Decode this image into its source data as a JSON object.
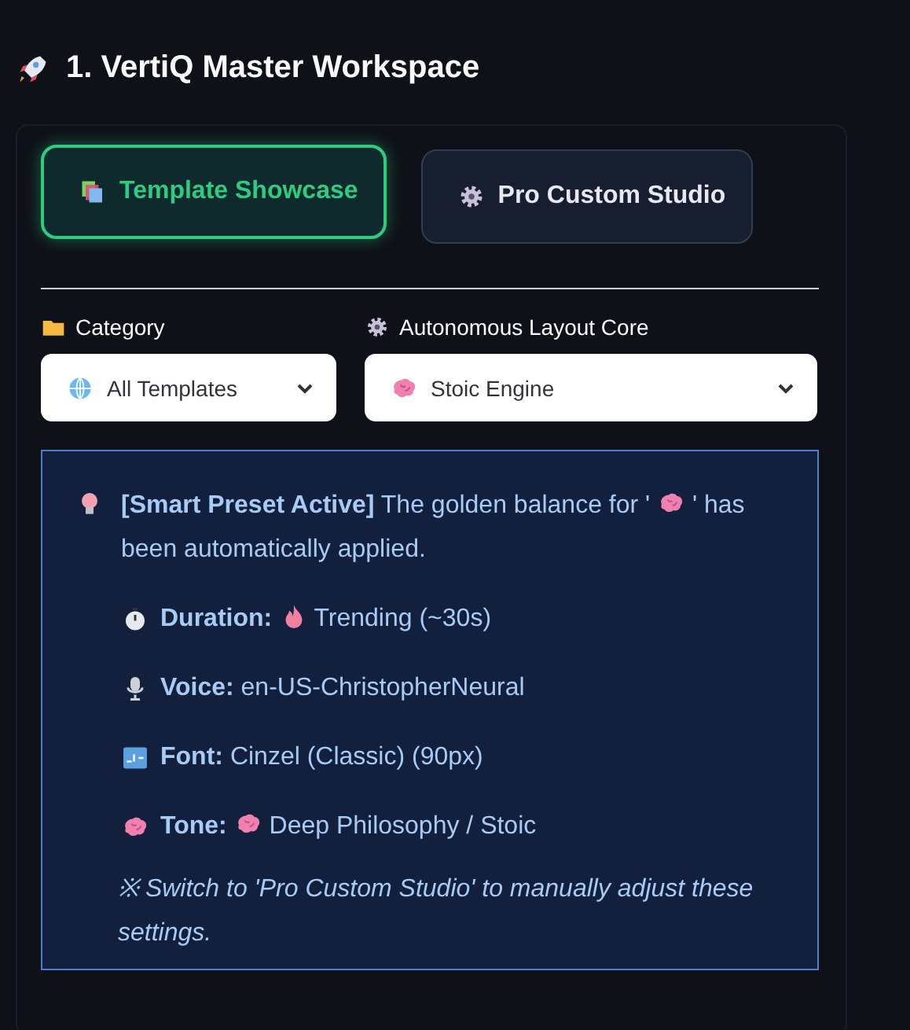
{
  "heading": {
    "text": "1. VertiQ Master Workspace"
  },
  "tabs": [
    {
      "label": "Template Showcase",
      "selected": true
    },
    {
      "label": "Pro Custom Studio",
      "selected": false
    }
  ],
  "selects": [
    {
      "label": "Category",
      "value": "All Templates"
    },
    {
      "label": "Autonomous Layout Core",
      "value": "Stoic Engine"
    }
  ],
  "info": {
    "lead": "[Smart Preset Active]",
    "text_before": "The golden balance for '",
    "text_after": "' has been automatically applied.",
    "details": [
      {
        "label": "Duration:",
        "value": "Trending (~30s)"
      },
      {
        "label": "Voice:",
        "value": "en-US-ChristopherNeural"
      },
      {
        "label": "Font:",
        "value": "Cinzel (Classic) (90px)"
      },
      {
        "label": "Tone:",
        "value": "Deep Philosophy / Stoic"
      }
    ],
    "note": "※ Switch to 'Pro Custom Studio' to manually adjust these settings."
  }
}
